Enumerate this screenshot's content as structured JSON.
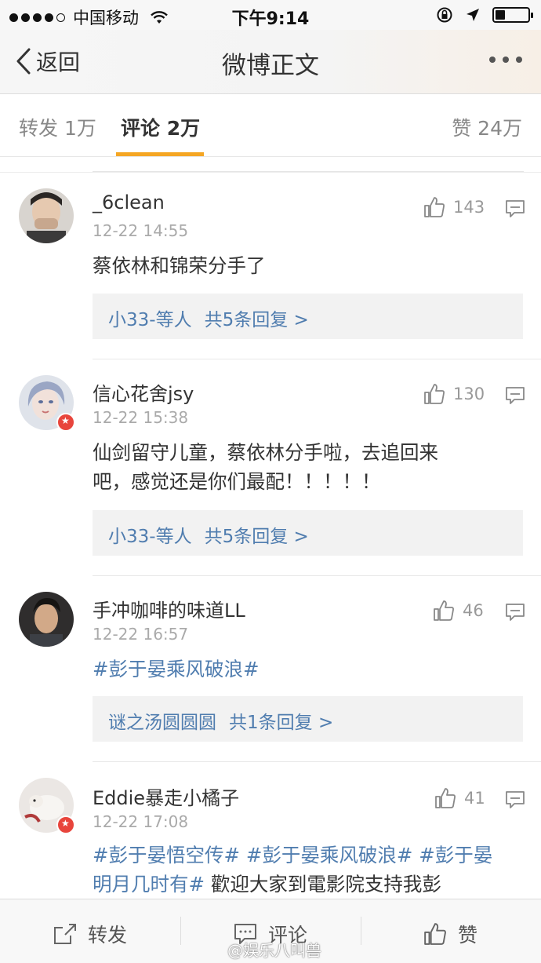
{
  "status_bar": {
    "carrier": "中国移动",
    "time": "下午9:14"
  },
  "nav": {
    "back_label": "返回",
    "title": "微博正文"
  },
  "tabs": [
    {
      "label": "转发 1万"
    },
    {
      "label": "评论 2万"
    },
    {
      "label": "赞 24万"
    }
  ],
  "comments": [
    {
      "name": "_6clean",
      "time": "12-22 14:55",
      "likes": "143",
      "text": "蔡依林和锦荣分手了",
      "reply_who": "小33-等人",
      "reply_total": "共5条回复 >"
    },
    {
      "name": "信心花舍jsy",
      "time": "12-22 15:38",
      "likes": "130",
      "text_line1": "仙剑留守儿童，蔡依林分手啦，去追回来",
      "text_line2": "吧，感觉还是你们最配！！！！！",
      "reply_who": "小33-等人",
      "reply_total": "共5条回复 >"
    },
    {
      "name": "手冲咖啡的味道LL",
      "time": "12-22 16:57",
      "likes": "46",
      "hashtag": "#彭于晏乘风破浪#",
      "reply_who": "谜之汤圆圆圆",
      "reply_total": "共1条回复 >"
    },
    {
      "name": "Eddie暴走小橘子",
      "time": "12-22 17:08",
      "likes": "41",
      "tag1": "#彭于晏悟空传#",
      "tag2": "#彭于晏乘风破浪#",
      "tag3a": "#彭于晏",
      "tag3b": "明月几时有#",
      "text_tail": " 歡迎大家到電影院支持我彭"
    }
  ],
  "toolbar": {
    "repost": "转发",
    "comment": "评论",
    "like": "赞"
  },
  "watermark": "@娱乐八叫兽",
  "colors": {
    "accent": "#f5a623",
    "link": "#507daf",
    "badge": "#e8453c"
  }
}
